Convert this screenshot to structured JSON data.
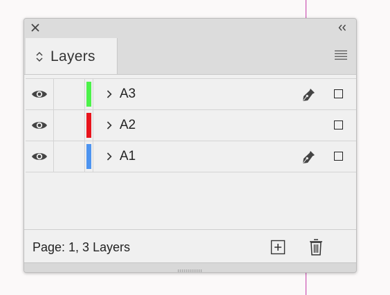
{
  "panel": {
    "tab_label": "Layers",
    "status": "Page: 1, 3 Layers"
  },
  "layers": [
    {
      "name": "A3",
      "color": "#4cf24a",
      "has_pen": true
    },
    {
      "name": "A2",
      "color": "#e8141c",
      "has_pen": false
    },
    {
      "name": "A1",
      "color": "#4d94f0",
      "has_pen": true
    }
  ],
  "colors": {
    "guide": "#c43aa8",
    "panel_bg": "#f0f0f0",
    "chrome_bg": "#dcdcdc"
  }
}
